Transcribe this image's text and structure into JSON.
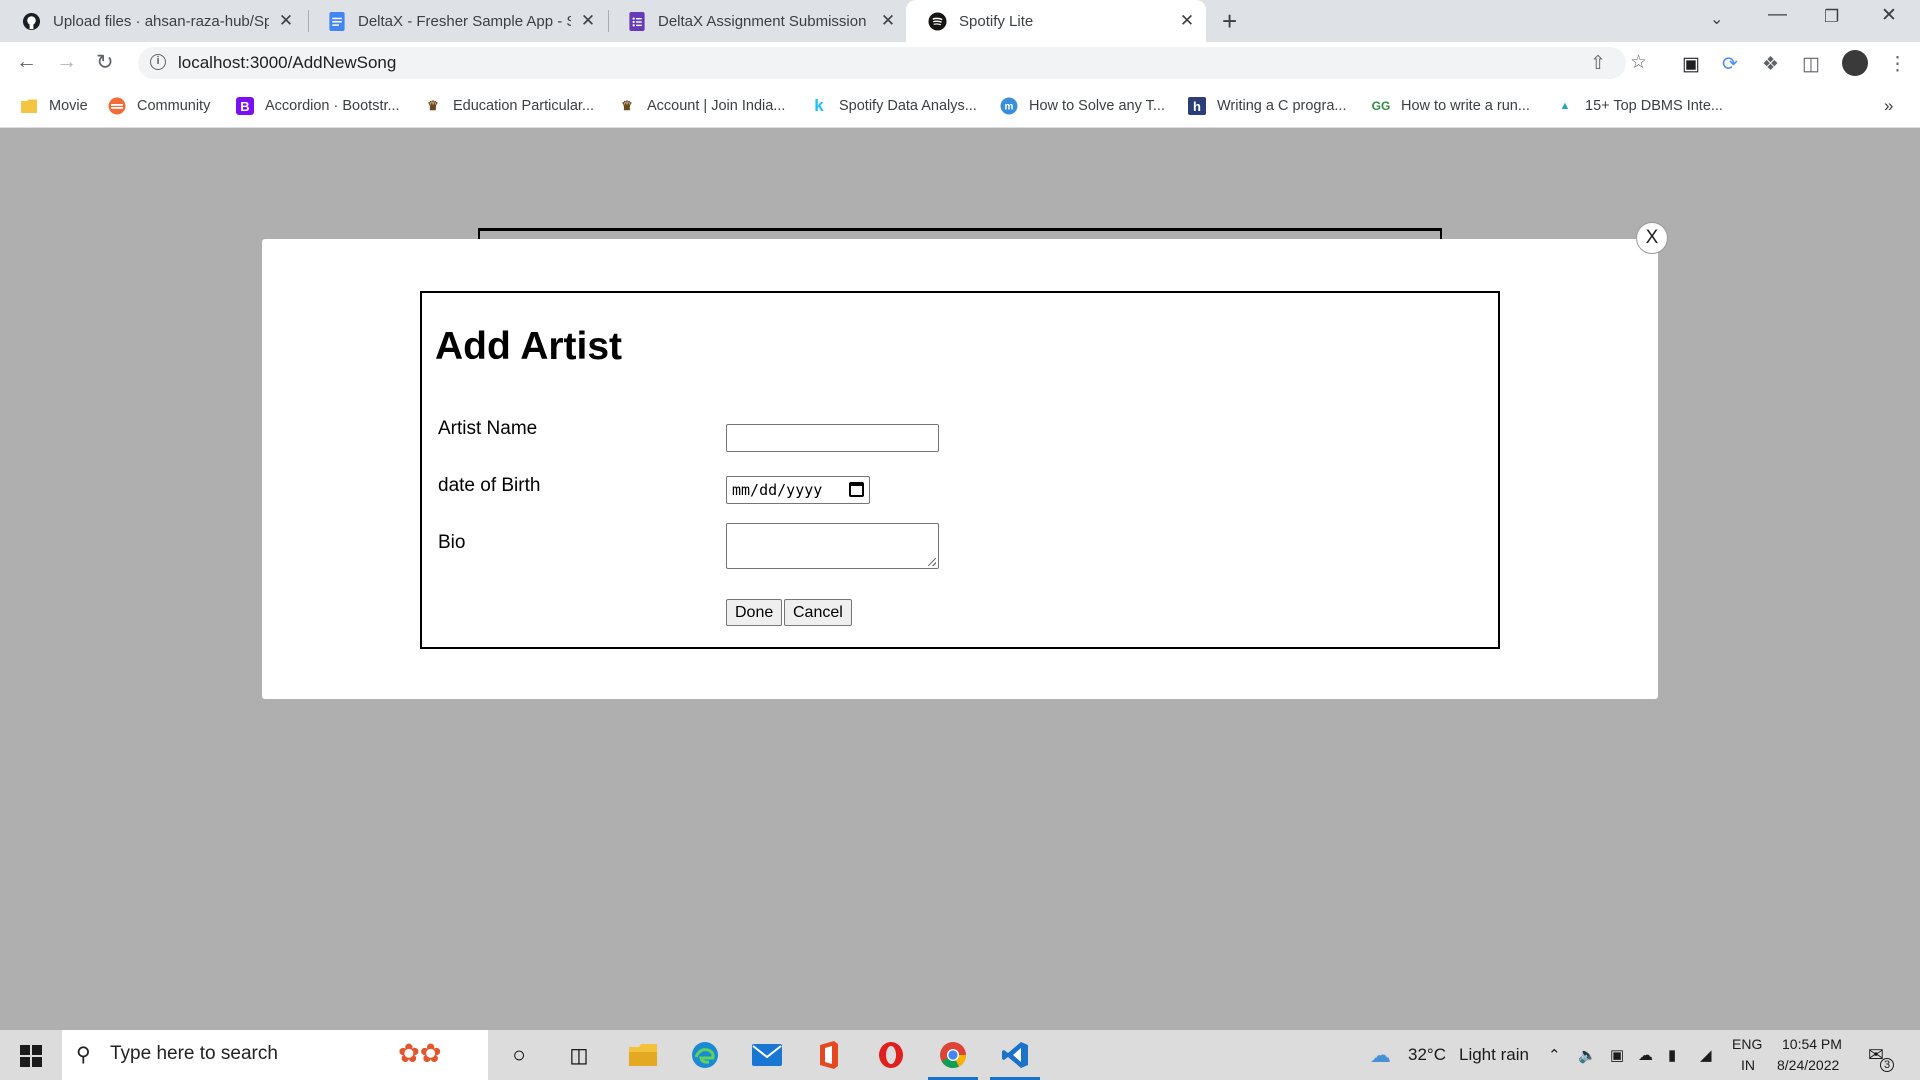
{
  "browser": {
    "tabs": [
      {
        "title": "Upload files · ahsan-raza-hub/Sp",
        "icon": "github-icon",
        "active": false
      },
      {
        "title": "DeltaX - Fresher Sample App - Sp",
        "icon": "google-docs-icon",
        "active": false
      },
      {
        "title": "DeltaX Assignment Submission -",
        "icon": "google-forms-icon",
        "active": false
      },
      {
        "title": "Spotify Lite",
        "icon": "spotify-icon",
        "active": true
      }
    ],
    "new_tab": "+",
    "tab_close": "✕",
    "url": "localhost:3000/AddNewSong",
    "bookmarks": [
      {
        "label": "Movie",
        "icon": "folder-icon"
      },
      {
        "label": "Community",
        "icon": "community-icon"
      },
      {
        "label": "Accordion · Bootstr...",
        "icon": "bootstrap-icon"
      },
      {
        "label": "Education Particular...",
        "icon": "emblem-icon"
      },
      {
        "label": "Account | Join India...",
        "icon": "emblem-icon"
      },
      {
        "label": "Spotify Data Analys...",
        "icon": "kaggle-icon"
      },
      {
        "label": "How to Solve any T...",
        "icon": "medium-icon"
      },
      {
        "label": "Writing a C progra...",
        "icon": "hashnode-icon"
      },
      {
        "label": "How to write a run...",
        "icon": "geeksforgeeks-icon"
      },
      {
        "label": "15+ Top DBMS Inte...",
        "icon": "chart-site-icon"
      }
    ],
    "bookmarks_overflow": "»"
  },
  "modal": {
    "close_label": "X",
    "title": "Add Artist",
    "fields": {
      "artist_name_label": "Artist Name",
      "artist_name_value": "",
      "dob_label": "date of Birth",
      "dob_placeholder": "mm/dd/yyyy",
      "bio_label": "Bio",
      "bio_value": ""
    },
    "done_label": "Done",
    "cancel_label": "Cancel"
  },
  "taskbar": {
    "search_placeholder": "Type here to search",
    "weather_temp": "32°C",
    "weather_text": "Light rain",
    "lang_top": "ENG",
    "lang_bottom": "IN",
    "time": "10:54 PM",
    "date": "8/24/2022",
    "notification_count": "3"
  },
  "colors": {
    "tabstrip": "#dee1e6",
    "page_overlay": "#afafaf",
    "taskbar": "#dcdcdc",
    "vscode_blue": "#1a73c8",
    "opera_red": "#e0201e"
  }
}
